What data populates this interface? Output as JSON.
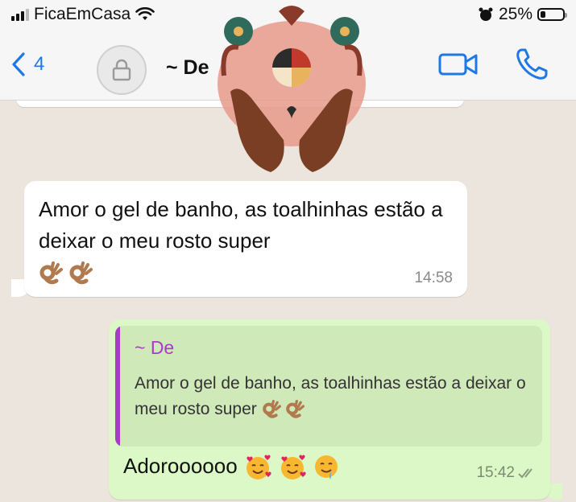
{
  "status": {
    "carrier": "FicaEmCasa",
    "battery": "25%",
    "battery_level": 0.25
  },
  "nav": {
    "back_count": "4",
    "title": "~ De"
  },
  "chat": {
    "incoming": {
      "text": "Amor o gel de banho, as toalhinhas estão a deixar o meu rosto super",
      "emoji": [
        "ok-hand",
        "ok-hand"
      ],
      "time": "14:58"
    },
    "outgoing": {
      "quote_author": "~ De",
      "quote_text": "Amor o gel de banho, as toalhinhas estão a deixar o meu rosto super",
      "text": "Adoroooooo",
      "emoji": [
        "smiling-face-with-hearts",
        "smiling-face-with-hearts",
        "drooling-face"
      ],
      "time": "15:42"
    }
  },
  "colors": {
    "accent": "#1e78e5",
    "quote_author": "#a83cc8",
    "outgoing_bg": "#dcf8c6"
  }
}
